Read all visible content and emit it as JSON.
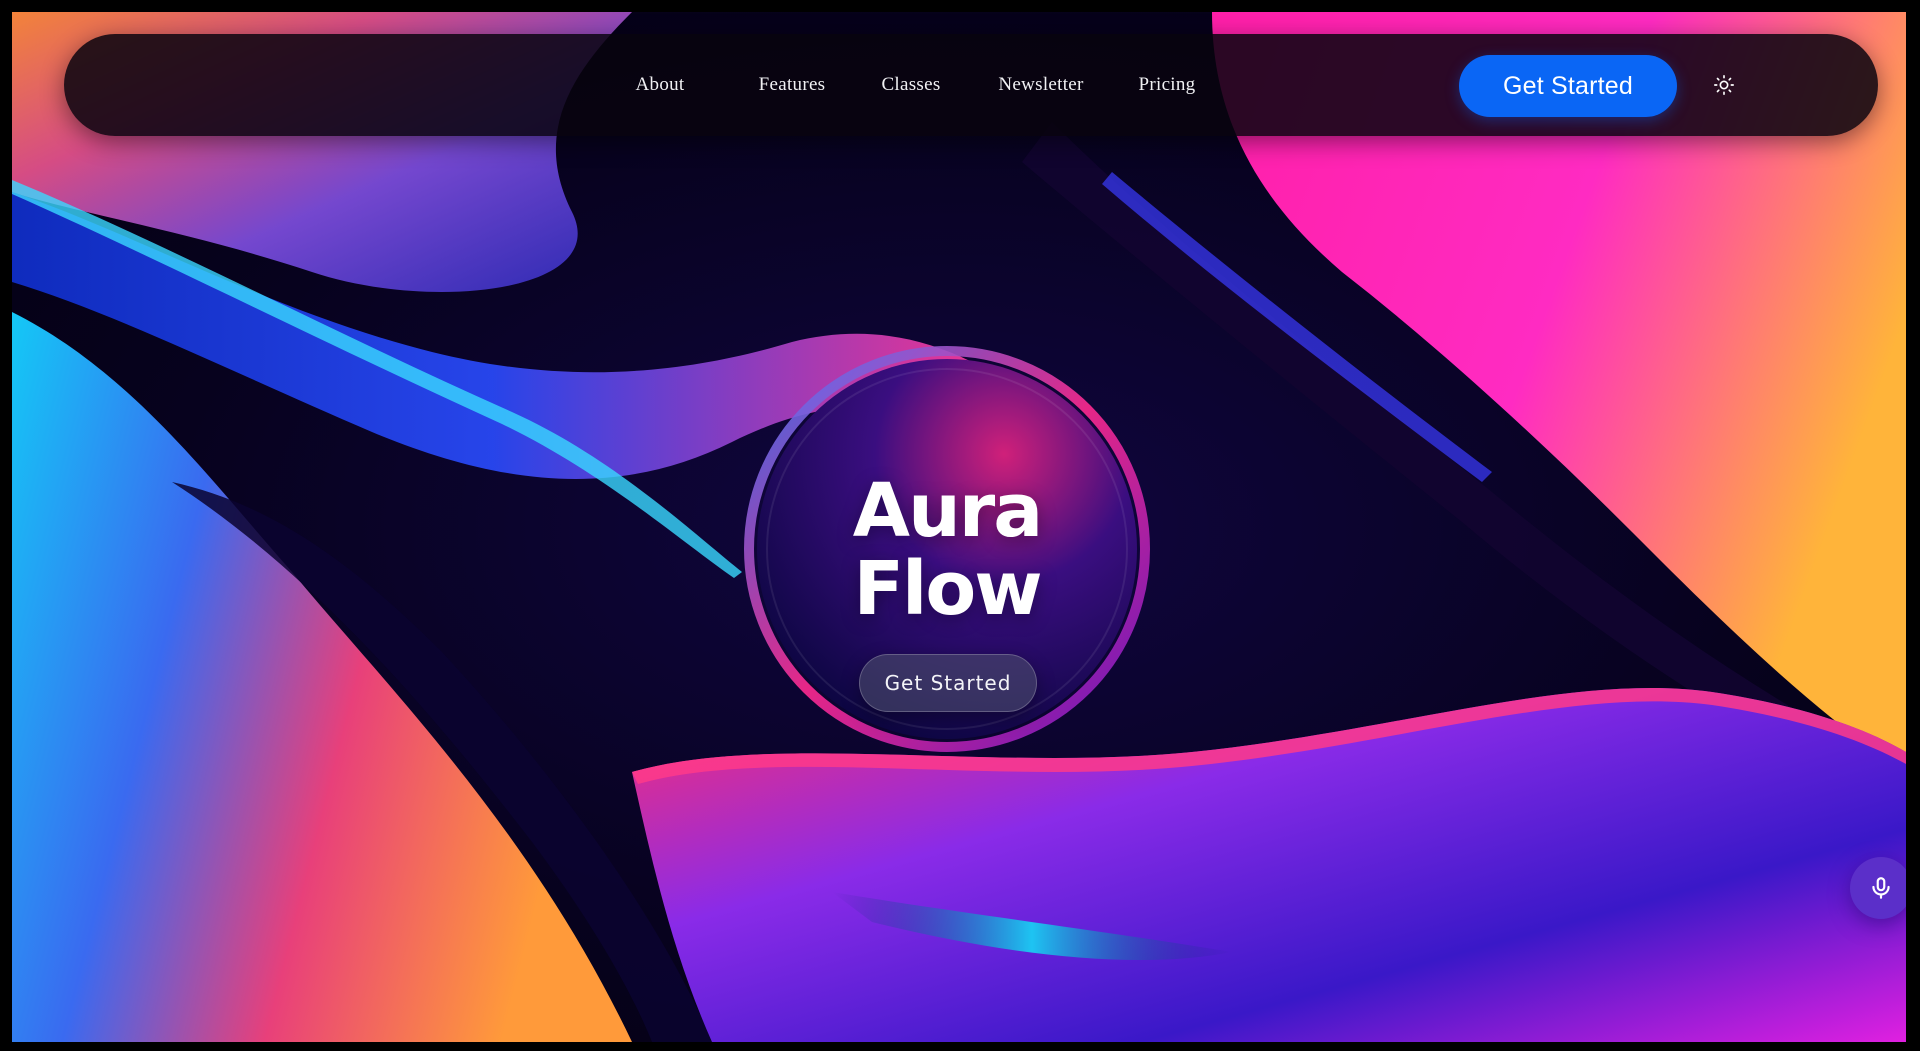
{
  "nav": {
    "links": [
      {
        "label": "About"
      },
      {
        "label": "Features"
      },
      {
        "label": "Classes"
      },
      {
        "label": "Newsletter"
      },
      {
        "label": "Pricing"
      }
    ],
    "cta_label": "Get Started",
    "theme_toggle_icon": "sun-icon"
  },
  "hero": {
    "title_line1": "Aura",
    "title_line2": "Flow",
    "cta_label": "Get Started"
  },
  "mic": {
    "icon": "microphone-icon"
  },
  "colors": {
    "nav_cta": "#0a66f5",
    "mic_button": "#5b2fc9",
    "background_magenta": "#ff2bc2",
    "background_cyan": "#18c8f5",
    "background_orange": "#ff8a3d",
    "background_navy": "#0a0330"
  }
}
